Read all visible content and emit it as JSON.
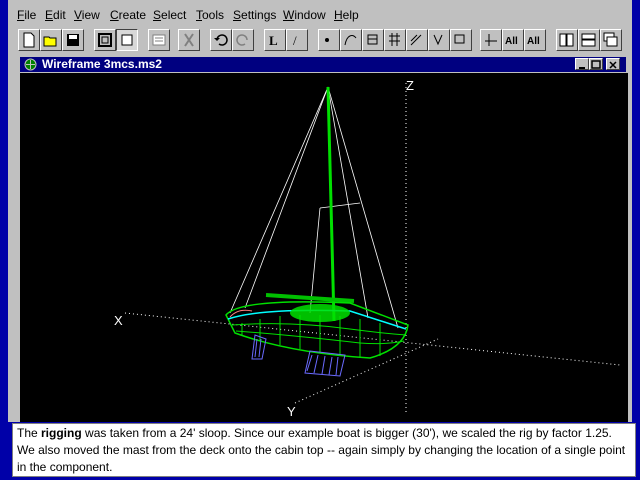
{
  "menu": [
    "File",
    "Edit",
    "View",
    "Create",
    "Select",
    "Tools",
    "Settings",
    "Window",
    "Help"
  ],
  "menu_mnemonics": [
    "F",
    "E",
    "V",
    "C",
    "S",
    "T",
    "S",
    "W",
    "H"
  ],
  "toolbar": {
    "icons": [
      "new-file-icon",
      "open-folder-icon",
      "save-icon",
      "frame-view-icon",
      "single-view-icon",
      "properties-icon",
      "cut-icon",
      "undo-icon",
      "redo-icon",
      "line-icon",
      "fraction-icon",
      "point-icon",
      "curve-icon",
      "surface-icon",
      "grid-icon",
      "sweep-icon",
      "arrow-down-icon",
      "rectangle-icon",
      "axis-icon",
      "all-plus-icon",
      "all-minus-icon",
      "tile-vertical-icon",
      "tile-horizontal-icon",
      "cascade-icon"
    ],
    "labels": {
      "line": "L",
      "fraction": "/",
      "all_plus": "All",
      "all_minus": "All"
    }
  },
  "window": {
    "title": "Wireframe 3mcs.ms2"
  },
  "axes": {
    "x": "X",
    "y": "Y",
    "z": "Z"
  },
  "caption": {
    "pre": "The ",
    "bold": "rigging",
    "post": " was taken from a 24' sloop. Since our example boat is bigger (30'), we scaled the rig by factor 1.25. We also moved the mast from the deck onto the cabin top -- again simply by changing the location of a single point in the component."
  },
  "colors": {
    "desktop": "#0000a8",
    "titlebar": "#000080",
    "viewport": "#000000",
    "hull": "#00e000",
    "keel": "#6a6aff",
    "rigging": "#ffffff",
    "deck": "#00ffff"
  }
}
